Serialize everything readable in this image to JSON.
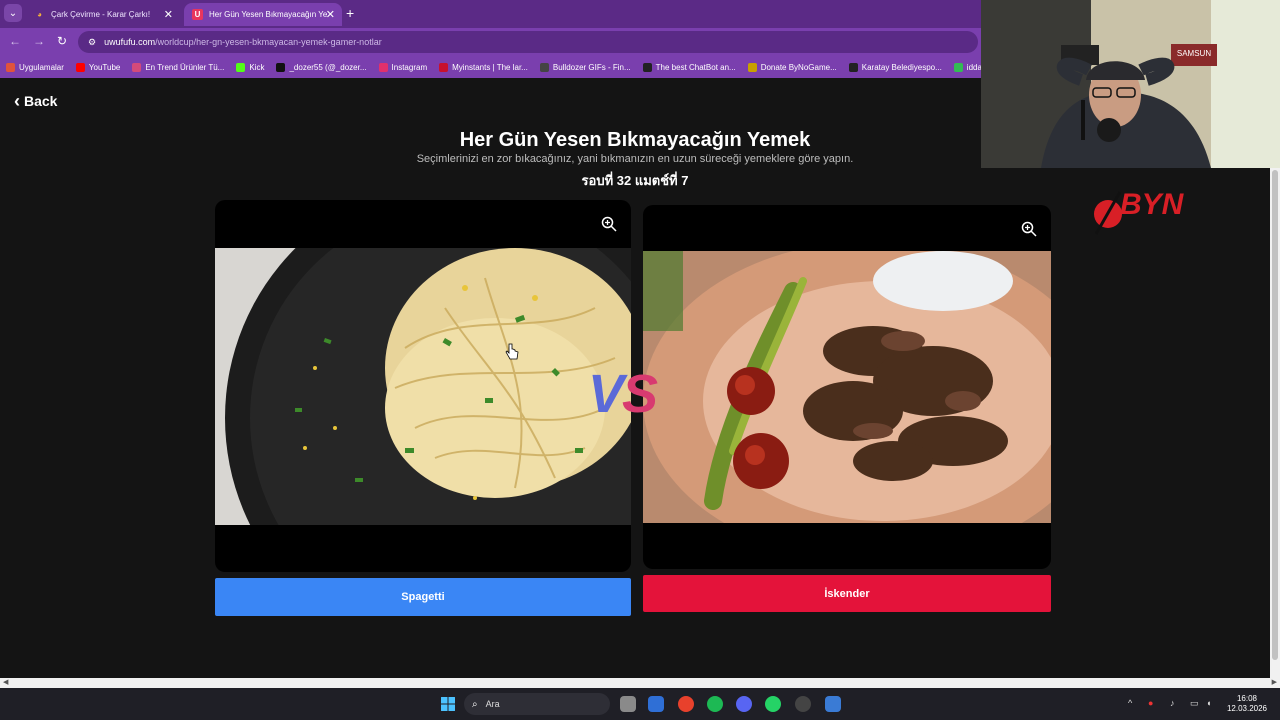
{
  "browser": {
    "tabs": [
      {
        "label": "Çark Çevirme - Karar Çarkı!",
        "active": false
      },
      {
        "label": "Her Gün Yesen Bıkmayacağın Ye",
        "active": true
      }
    ],
    "url": {
      "host": "uwufufu.com",
      "path": "/worldcup/her-gn-yesen-bkmayacan-yemek-gamer-notlar"
    },
    "bookmarks": [
      {
        "label": "Uygulamalar",
        "icon": "apps-grid-icon",
        "color": "#e0533d"
      },
      {
        "label": "YouTube",
        "icon": "youtube-icon",
        "color": "#ff0000"
      },
      {
        "label": "En Trend Ürünler Tü...",
        "icon": "shop-icon",
        "color": "#d44a7a"
      },
      {
        "label": "Kick",
        "icon": "kick-icon",
        "color": "#53fc18"
      },
      {
        "label": "_dozer55 (@_dozer...",
        "icon": "tiktok-icon",
        "color": "#111111"
      },
      {
        "label": "Instagram",
        "icon": "instagram-icon",
        "color": "#e1306c"
      },
      {
        "label": "Myinstants | The lar...",
        "icon": "myinstants-icon",
        "color": "#c8102e"
      },
      {
        "label": "Bulldozer GIFs - Fin...",
        "icon": "giphy-icon",
        "color": "#444444"
      },
      {
        "label": "The best ChatBot an...",
        "icon": "chatbot-icon",
        "color": "#222222"
      },
      {
        "label": "Donate ByNoGame...",
        "icon": "bynogame-icon",
        "color": "#c9a000"
      },
      {
        "label": "Karatay Belediyespo...",
        "icon": "check-icon",
        "color": "#222222"
      },
      {
        "label": "idda",
        "icon": "bet-icon",
        "color": "#3b5"
      }
    ]
  },
  "page": {
    "back_label": "Back",
    "title": "Her Gün Yesen Bıkmayacağın Yemek",
    "subtitle": "Seçimlerinizi en zor bıkacağınız, yani bıkmanızın en uzun süreceği yemeklere göre yapın.",
    "round_text": "รอบที่ 32 แมตช์ที่ 7",
    "vs_v": "V",
    "vs_s": "S",
    "left_choice": "Spagetti",
    "right_choice": "İskender"
  },
  "overlay": {
    "cam_sign": "SAMSUN",
    "logo_text": "BYN"
  },
  "taskbar": {
    "search_placeholder": "Ara",
    "time": "16:08",
    "date": "12.03.2026"
  },
  "colors": {
    "tab_bar": "#5b2a86",
    "toolbar": "#7a3fae",
    "left_button": "#3a86f5",
    "right_button": "#e4133a",
    "vs_v": "#5b6ad8",
    "vs_s": "#d83a70"
  }
}
